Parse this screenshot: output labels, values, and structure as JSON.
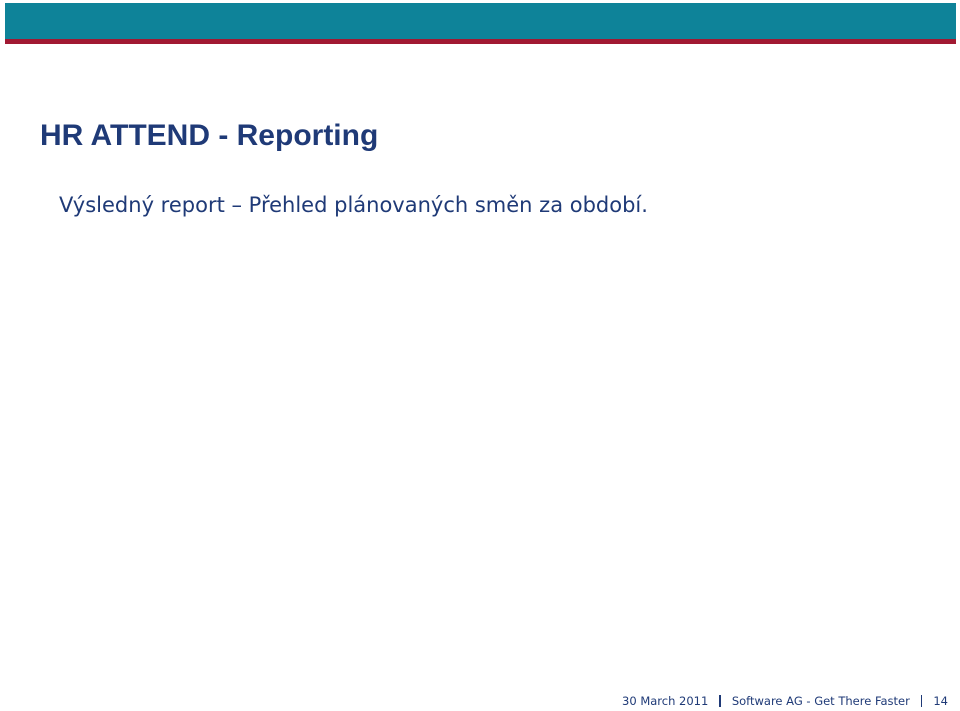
{
  "slide": {
    "title": "HR ATTEND - Reporting",
    "subtitle": "Výsledný report – Přehled plánovaných směn za období."
  },
  "footer": {
    "date": "30 March 2011",
    "company": "Software AG - Get There Faster",
    "page_number": "14"
  },
  "colors": {
    "header_band": "#0e8399",
    "header_rule": "#a11932",
    "text": "#1f3a77"
  }
}
